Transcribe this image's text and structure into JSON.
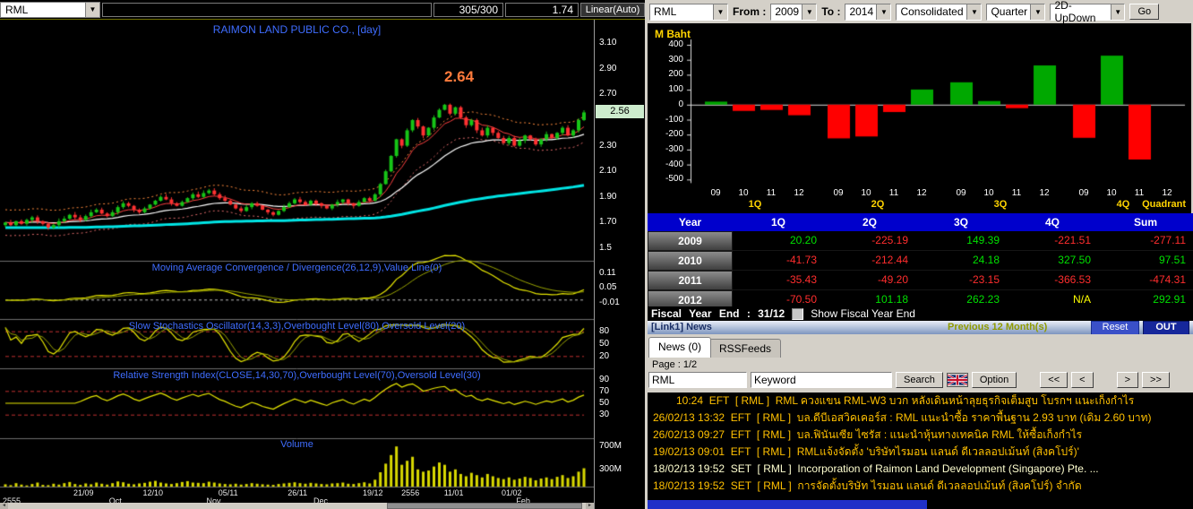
{
  "left_toolbar": {
    "symbol": "RML",
    "bid_ask": "305/300",
    "last": "1.74",
    "scale_mode": "Linear(Auto)"
  },
  "right_toolbar": {
    "symbol": "RML",
    "from_label": "From :",
    "from": "2009",
    "to_label": "To :",
    "to": "2014",
    "consolidated": "Consolidated",
    "period": "Quarter",
    "view": "2D-UpDown",
    "go": "Go"
  },
  "fiscal": {
    "label": "Fiscal Year End : 31/12",
    "checkbox_label": "Show Fiscal Year End"
  },
  "link_bar": {
    "title": "[Link1] News",
    "prev": "Previous 12 Month(s)",
    "reset": "Reset",
    "out": "OUT"
  },
  "tabs": {
    "news": "News (0)",
    "rss": "RSSFeeds"
  },
  "pager": {
    "label": "Page : 1/2"
  },
  "search": {
    "symbol": "RML",
    "keyword": "Keyword",
    "search_label": "Search",
    "option_label": "Option",
    "nav": [
      "<<",
      "<",
      ">",
      ">>"
    ]
  },
  "quarter_table": {
    "headers": [
      "Year",
      "1Q",
      "2Q",
      "3Q",
      "4Q",
      "Sum"
    ],
    "rows": [
      {
        "year": "2009",
        "cells": [
          "20.20",
          "-225.19",
          "149.39",
          "-221.51",
          "-277.11"
        ]
      },
      {
        "year": "2010",
        "cells": [
          "-41.73",
          "-212.44",
          "24.18",
          "327.50",
          "97.51"
        ]
      },
      {
        "year": "2011",
        "cells": [
          "-35.43",
          "-49.20",
          "-23.15",
          "-366.53",
          "-474.31"
        ]
      },
      {
        "year": "2012",
        "cells": [
          "-70.50",
          "101.18",
          "262.23",
          "N/A",
          "292.91"
        ]
      }
    ]
  },
  "news": {
    "items": [
      {
        "time": "10:24",
        "src": "EFT",
        "symbol": "RML",
        "text": "RML ควงแขน RML-W3 บวก หลังเดินหน้าลุยธุรกิจเต็มสูบ โบรกฯ แนะเก็งกำไร",
        "color": "#ffc000",
        "indent": true
      },
      {
        "time": "26/02/13 13:32",
        "src": "EFT",
        "symbol": "RML",
        "text": "บล.ดีบีเอสวิคเคอร์ส : RML แนะนำซื้อ ราคาพื้นฐาน 2.93 บาท (เดิม 2.60 บาท)",
        "color": "#ffc000"
      },
      {
        "time": "26/02/13 09:27",
        "src": "EFT",
        "symbol": "RML",
        "text": "บล.ฟินันเซีย ไซรัส : แนะนำหุ้นทางเทคนิค RML ให้ซื้อเก็งกำไร",
        "color": "#ffc000"
      },
      {
        "time": "19/02/13 09:01",
        "src": "EFT",
        "symbol": "RML",
        "text": "RMLแจ้งจัดตั้ง 'บริษัทไรมอน แลนด์ ดีเวลลอปเม้นท์ (สิงคโปร์)'",
        "color": "#ffc000"
      },
      {
        "time": "18/02/13 19:52",
        "src": "SET",
        "symbol": "RML",
        "text": "Incorporation of Raimon Land Development (Singapore) Pte. ...",
        "color": "#ffffd0"
      },
      {
        "time": "18/02/13 19:52",
        "src": "SET",
        "symbol": "RML",
        "text": "การจัดตั้งบริษัท ไรมอน แลนด์ ดีเวลลอปเม้นท์ (สิงคโปร์) จำกัด",
        "color": "#ffc000"
      }
    ]
  },
  "chart_data": [
    {
      "type": "candlestick",
      "title": "RAIMON LAND PUBLIC CO., [day]",
      "annotation": "2.64",
      "last_price": "2.56",
      "ylim": [
        1.45,
        3.2
      ],
      "y_ticks": [
        "3.10",
        "2.90",
        "2.70",
        "2.30",
        "2.10",
        "1.90",
        "1.70",
        "1.5"
      ],
      "closes": [
        1.7,
        1.68,
        1.71,
        1.69,
        1.72,
        1.74,
        1.71,
        1.69,
        1.66,
        1.68,
        1.71,
        1.73,
        1.76,
        1.74,
        1.72,
        1.75,
        1.78,
        1.8,
        1.77,
        1.75,
        1.78,
        1.82,
        1.85,
        1.83,
        1.8,
        1.78,
        1.81,
        1.84,
        1.87,
        1.9,
        1.88,
        1.85,
        1.83,
        1.86,
        1.89,
        1.92,
        1.9,
        1.93,
        1.95,
        1.92,
        1.89,
        1.87,
        1.84,
        1.81,
        1.79,
        1.82,
        1.85,
        1.83,
        1.8,
        1.78,
        1.76,
        1.79,
        1.82,
        1.85,
        1.88,
        1.86,
        1.84,
        1.87,
        1.85,
        1.83,
        1.81,
        1.84,
        1.86,
        1.88,
        1.85,
        1.83,
        1.86,
        1.89,
        1.87,
        1.92,
        2.0,
        2.1,
        2.22,
        2.35,
        2.3,
        2.42,
        2.5,
        2.45,
        2.38,
        2.44,
        2.52,
        2.58,
        2.62,
        2.55,
        2.6,
        2.52,
        2.46,
        2.5,
        2.42,
        2.38,
        2.44,
        2.4,
        2.36,
        2.32,
        2.36,
        2.3,
        2.34,
        2.38,
        2.35,
        2.31,
        2.35,
        2.39,
        2.36,
        2.4,
        2.44,
        2.38,
        2.42,
        2.5,
        2.56
      ],
      "volumes": [
        40,
        25,
        60,
        35,
        20,
        45,
        70,
        30,
        25,
        50,
        35,
        60,
        80,
        45,
        30,
        55,
        40,
        70,
        50,
        35,
        60,
        90,
        75,
        50,
        40,
        55,
        65,
        85,
        100,
        70,
        55,
        45,
        60,
        80,
        95,
        70,
        65,
        60,
        85,
        70,
        55,
        45,
        40,
        50,
        35,
        45,
        60,
        50,
        40,
        35,
        30,
        45,
        55,
        65,
        75,
        60,
        50,
        65,
        55,
        45,
        40,
        55,
        60,
        70,
        50,
        45,
        60,
        75,
        55,
        120,
        250,
        400,
        550,
        700,
        380,
        450,
        520,
        300,
        260,
        280,
        350,
        420,
        380,
        260,
        300,
        220,
        180,
        240,
        200,
        160,
        220,
        180,
        150,
        130,
        160,
        120,
        140,
        170,
        150,
        110,
        140,
        160,
        130,
        170,
        200,
        150,
        180,
        260,
        320
      ],
      "x_labels": [
        {
          "t": "21/09",
          "f": 0.135
        },
        {
          "t": "12/10",
          "f": 0.255
        },
        {
          "t": "05/11",
          "f": 0.385
        },
        {
          "t": "26/11",
          "f": 0.505
        },
        {
          "t": "19/12",
          "f": 0.635
        },
        {
          "t": "2556",
          "f": 0.7
        },
        {
          "t": "11/01",
          "f": 0.775
        },
        {
          "t": "01/02",
          "f": 0.875
        }
      ],
      "month_labels": [
        {
          "t": "Oct",
          "f": 0.19
        },
        {
          "t": "Nov",
          "f": 0.36
        },
        {
          "t": "Dec",
          "f": 0.545
        },
        {
          "t": "Feb",
          "f": 0.895
        }
      ],
      "year_label": "2555",
      "panels": {
        "macd": {
          "title": "Moving Average Convergence / Divergence(26,12,9),Value Line(0)",
          "ticks": [
            "0.11",
            "0.05",
            "-0.01"
          ]
        },
        "stoch": {
          "title": "Slow Stochastics Oscillator(14,3,3),Overbought Level(80),Oversold Level(20)",
          "ticks": [
            "80",
            "50",
            "20"
          ]
        },
        "rsi": {
          "title": "Relative Strength Index(CLOSE,14,30,70),Overbought Level(70),Oversold Level(30)",
          "ticks": [
            "90",
            "70",
            "50",
            "30"
          ]
        },
        "volume": {
          "title": "Volume",
          "ticks": [
            "700M",
            "300M"
          ]
        }
      }
    },
    {
      "type": "bar",
      "unit": "M Baht",
      "y_ticks": [
        400,
        300,
        200,
        100,
        0,
        -100,
        -200,
        -300,
        -400,
        -500
      ],
      "groups": [
        "1Q",
        "2Q",
        "3Q",
        "4Q"
      ],
      "years": [
        "09",
        "10",
        "11",
        "12"
      ],
      "values": [
        [
          20.2,
          -41.73,
          -35.43,
          -70.5
        ],
        [
          -225.19,
          -212.44,
          -49.2,
          101.18
        ],
        [
          149.39,
          24.18,
          -23.15,
          262.23
        ],
        [
          -221.51,
          327.5,
          -366.53,
          null
        ]
      ],
      "right_label": "Quadrant",
      "pos_color": "#00a800",
      "neg_color": "#ff0000"
    }
  ]
}
